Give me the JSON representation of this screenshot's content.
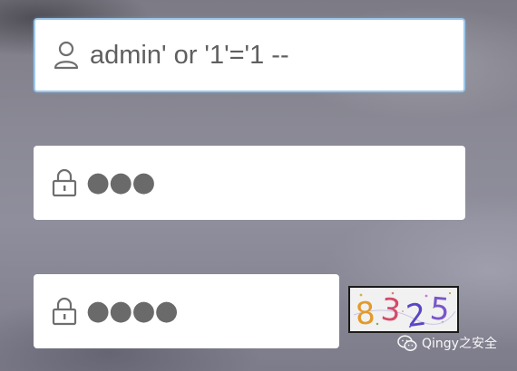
{
  "login_form": {
    "username": {
      "value": "admin' or '1'='1 --",
      "icon": "user-icon"
    },
    "password": {
      "masked_value": "●●●",
      "icon": "lock-icon"
    },
    "captcha": {
      "masked_value": "●●●●",
      "icon": "lock-icon",
      "image_text": [
        "8",
        "3",
        "2",
        "5"
      ],
      "image_colors": [
        "#e39a2c",
        "#d34b6a",
        "#5a46c4",
        "#7a56c9"
      ]
    }
  },
  "watermark": {
    "text": "Qingy之安全",
    "icon": "wechat-icon"
  },
  "colors": {
    "focus_border": "#9ec8ea",
    "field_background": "#ffffff",
    "text": "#5f5f5f"
  }
}
